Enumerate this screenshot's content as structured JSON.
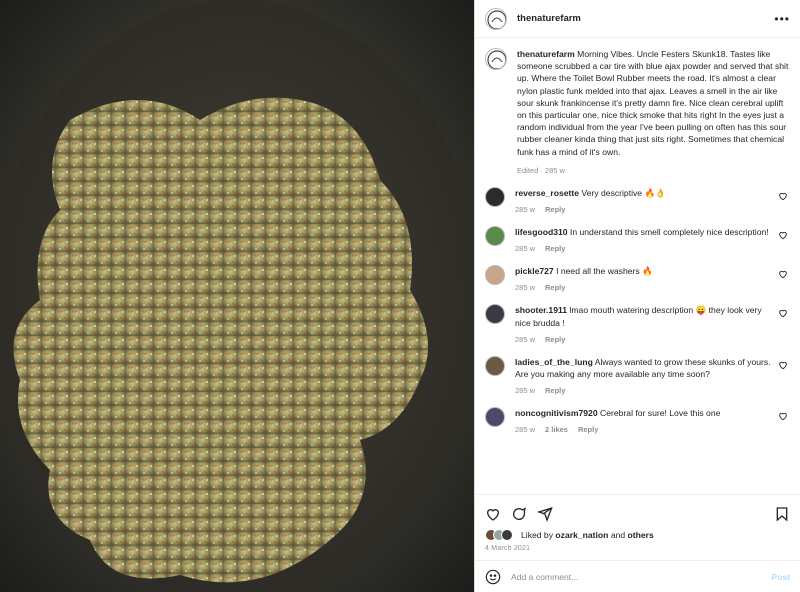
{
  "header": {
    "username": "thenaturefarm",
    "more_icon": "more-horizontal-icon"
  },
  "caption": {
    "username": "thenaturefarm",
    "text": "Morning Vibes. Uncle Festers Skunk18. Tastes like someone scrubbed a car tire with blue ajax powder and served that shit up. Where the Toilet Bowl Rubber meets the road. It's almost a clear nylon plastic funk melded into that ajax. Leaves a smell in the air like sour skunk frankincense it's pretty damn fire. Nice clean cerebral uplift on this particular one, nice thick smoke that hits right In the eyes just a random individual from the year I've been pulling on often has this sour rubber cleaner kinda thing that just sits right. Sometimes that chemical funk has a mind of it's own.",
    "meta": "Edited · 285 w"
  },
  "comments": [
    {
      "user": "reverse_rosette",
      "text": "Very descriptive 🔥👌",
      "age": "285 w",
      "likes": "",
      "reply": "Reply",
      "avatar_color": "#2b2b2b"
    },
    {
      "user": "lifesgood310",
      "text": "In understand this smell completely nice description!",
      "age": "285 w",
      "likes": "",
      "reply": "Reply",
      "avatar_color": "#5a8a4a"
    },
    {
      "user": "pickle727",
      "text": "I need all the washers 🔥",
      "age": "285 w",
      "likes": "",
      "reply": "Reply",
      "avatar_color": "#c9a58c"
    },
    {
      "user": "shooter.1911",
      "text": "lmao mouth watering description 😛 they look very nice brudda !",
      "age": "285 w",
      "likes": "",
      "reply": "Reply",
      "avatar_color": "#3a3a44"
    },
    {
      "user": "ladies_of_the_lung",
      "text": "Always wanted to grow these skunks of yours. Are you making any more available any time soon?",
      "age": "285 w",
      "likes": "",
      "reply": "Reply",
      "avatar_color": "#6d5a44"
    },
    {
      "user": "noncognitivism7920",
      "text": "Cerebral for sure! Love this one",
      "age": "285 w",
      "likes": "2 likes",
      "reply": "Reply",
      "avatar_color": "#4a4a6a"
    }
  ],
  "actions": {
    "liked_by_prefix": "Liked by",
    "liked_by_user": "ozark_nation",
    "liked_by_and": "and",
    "liked_by_others": "others",
    "date": "4 March 2021"
  },
  "add_comment": {
    "placeholder": "Add a comment...",
    "post_label": "Post"
  },
  "colors": {
    "accent": "#0095f6",
    "post_disabled": "#b2dffc",
    "muted": "#8e8e8e"
  }
}
